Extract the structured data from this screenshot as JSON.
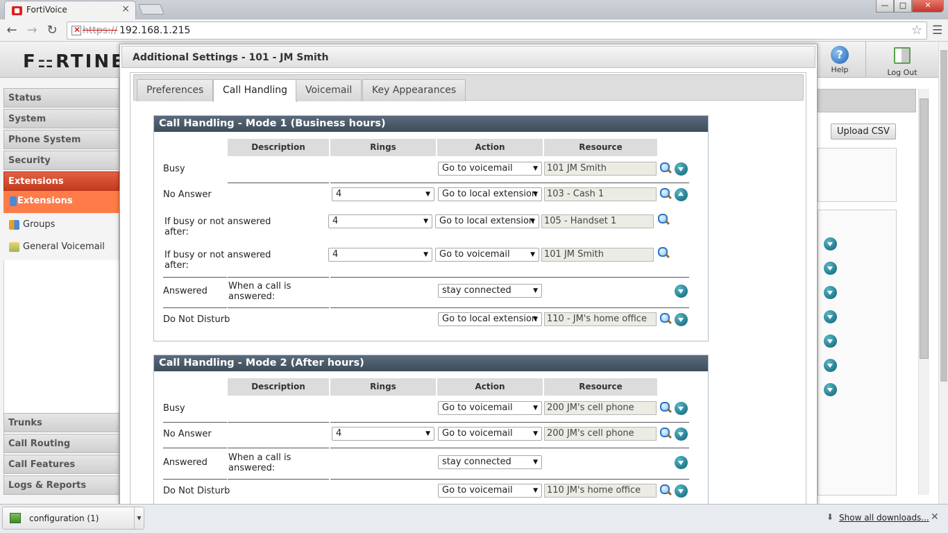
{
  "browser": {
    "tab_title": "FortiVoice",
    "url_scheme": "https://",
    "url_host": "192.168.1.215"
  },
  "app": {
    "logo": "F⚏RTINET",
    "help_label": "Help",
    "logout_label": "Log Out",
    "upload_csv": "Upload CSV"
  },
  "sidebar": {
    "status": "Status",
    "system": "System",
    "phone_system": "Phone System",
    "security": "Security",
    "extensions": "Extensions",
    "sub_extensions": "Extensions",
    "sub_groups": "Groups",
    "sub_general_voicemail": "General Voicemail",
    "trunks": "Trunks",
    "call_routing": "Call Routing",
    "call_features": "Call Features",
    "logs_reports": "Logs & Reports"
  },
  "modal": {
    "title": "Additional Settings - 101 - JM Smith",
    "tabs": {
      "preferences": "Preferences",
      "call_handling": "Call Handling",
      "voicemail": "Voicemail",
      "key_appearances": "Key Appearances"
    },
    "columns": {
      "description": "Description",
      "rings": "Rings",
      "action": "Action",
      "resource": "Resource"
    },
    "mode1": {
      "title": "Call Handling - Mode 1 (Business hours)",
      "busy": {
        "label": "Busy",
        "action": "Go to voicemail",
        "resource": "101 JM Smith"
      },
      "no_answer": {
        "label": "No Answer",
        "rings": "4",
        "action": "Go to local extension",
        "resource": "103 - Cash 1"
      },
      "if_busy_1": {
        "label_line1": "If busy or not answered",
        "label_line2": "after:",
        "rings": "4",
        "action": "Go to local extension",
        "resource": "105 - Handset 1"
      },
      "if_busy_2": {
        "label_line1": "If busy or not answered",
        "label_line2": "after:",
        "rings": "4",
        "action": "Go to voicemail",
        "resource": "101 JM Smith"
      },
      "answered": {
        "label": "Answered",
        "desc_line1": "When a call is",
        "desc_line2": "answered:",
        "action": "stay connected"
      },
      "dnd": {
        "label": "Do Not Disturb",
        "action": "Go to local extension",
        "resource": "110 - JM's home office"
      }
    },
    "mode2": {
      "title": "Call Handling - Mode 2 (After hours)",
      "busy": {
        "label": "Busy",
        "action": "Go to voicemail",
        "resource": "200 JM's cell phone"
      },
      "no_answer": {
        "label": "No Answer",
        "rings": "4",
        "action": "Go to voicemail",
        "resource": "200 JM's cell phone"
      },
      "answered": {
        "label": "Answered",
        "desc_line1": "When a call is",
        "desc_line2": "answered:",
        "action": "stay connected"
      },
      "dnd": {
        "label": "Do Not Disturb",
        "action": "Go to voicemail",
        "resource": "110 JM's home office"
      }
    }
  },
  "downloads": {
    "file_name": "configuration (1)",
    "show_all": "Show all downloads..."
  },
  "colors": {
    "menu_active": "#c23b1f",
    "submenu_active": "#ff7c48",
    "section_header": "#3e4c5a"
  }
}
